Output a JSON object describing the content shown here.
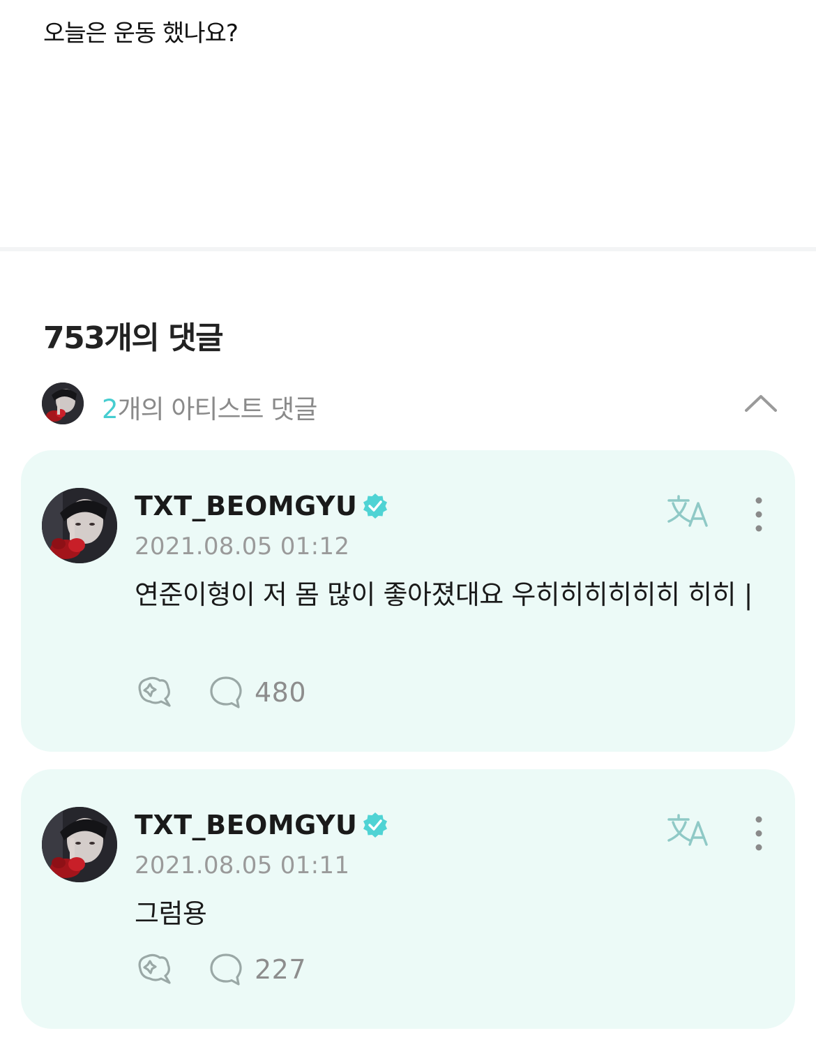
{
  "post": {
    "text": "오늘은 운동 했나요?"
  },
  "comments_section": {
    "count_label": "753개의 댓글",
    "artist_comments": {
      "count": "2",
      "label": "개의 아티스트 댓글",
      "icon": "chevron-up-icon"
    }
  },
  "comments": [
    {
      "author": "TXT_BEOMGYU",
      "verified": true,
      "timestamp": "2021.08.05 01:12",
      "text": "연준이형이 저 몸 많이 좋아졌대요 우히히히히히히 히히 |",
      "reply_count": "480"
    },
    {
      "author": "TXT_BEOMGYU",
      "verified": true,
      "timestamp": "2021.08.05 01:11",
      "text": "그럼용",
      "reply_count": "227"
    }
  ],
  "colors": {
    "accent": "#46cdd0",
    "card_bg": "#ecfaf7",
    "verified_badge": "#4fd3d4"
  }
}
